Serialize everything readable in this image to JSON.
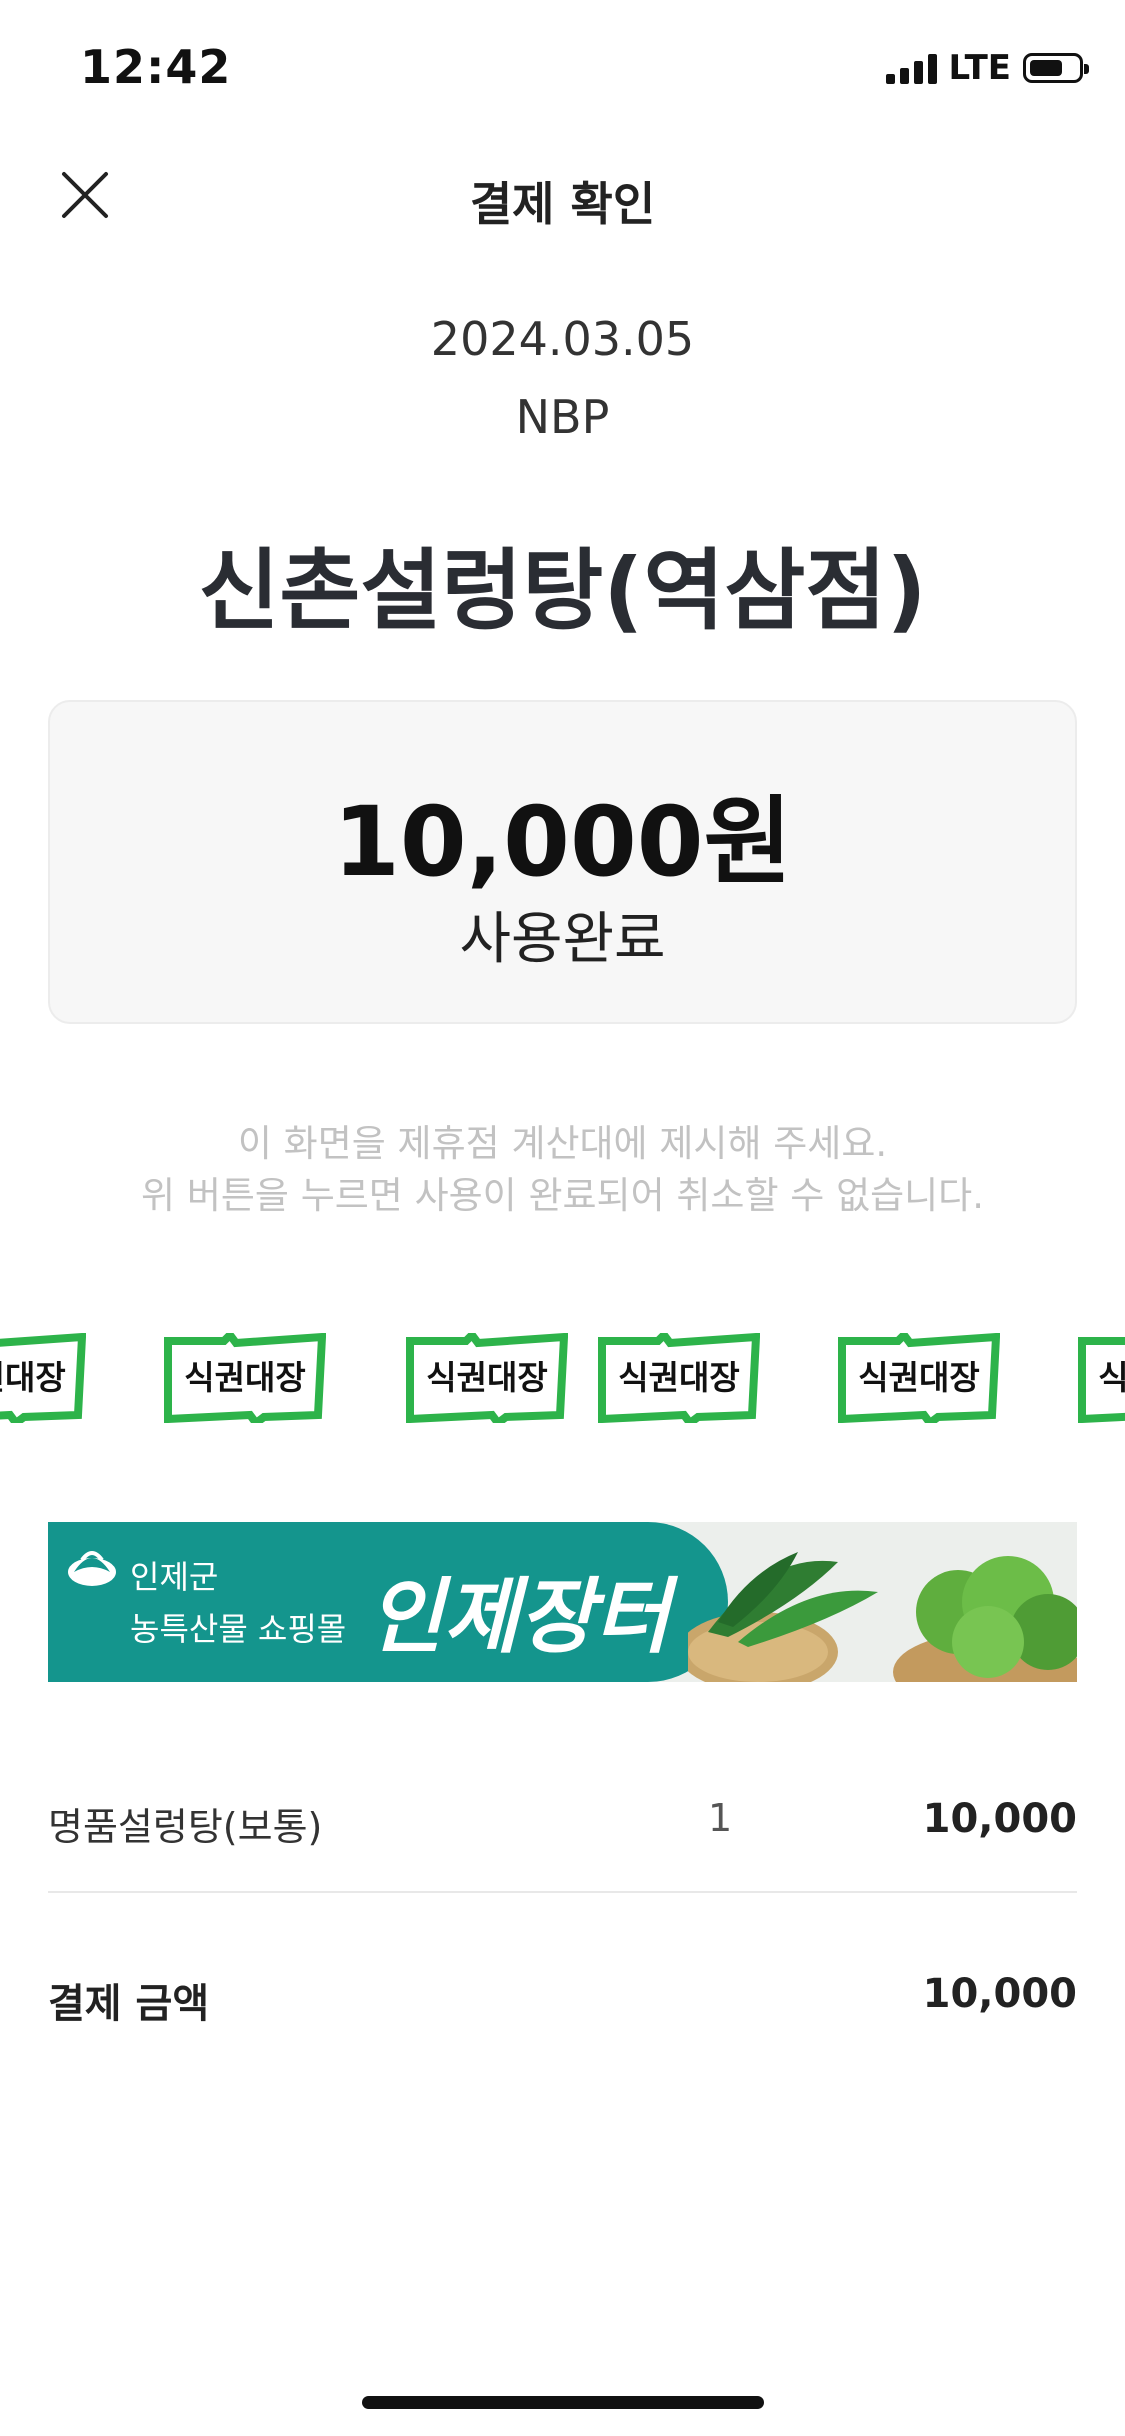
{
  "status_bar": {
    "time": "12:42",
    "network": "LTE",
    "battery_level": 0.7
  },
  "header": {
    "title": "결제 확인",
    "close_icon": "close-icon"
  },
  "receipt": {
    "date": "2024.03.05",
    "merchant": "NBP",
    "store_name": "신촌설렁탕(역삼점)",
    "amount": "10,000원",
    "status": "사용완료"
  },
  "notice": {
    "line1": "이 화면을 제휴점 계산대에 제시해 주세요.",
    "line2": "위 버튼을 누르면 사용이 완료되어 취소할 수 없습니다."
  },
  "stamps": {
    "label": "식권대장",
    "color": "#2db34a",
    "count": 6
  },
  "banner": {
    "subtitle_line1": "인제군",
    "subtitle_line2": "농특산물 쇼핑몰",
    "title": "인제장터",
    "brand_color": "#14958d"
  },
  "order": {
    "items": [
      {
        "name": "명품설렁탕(보통)",
        "qty": "1",
        "price": "10,000"
      }
    ],
    "total_label": "결제 금액",
    "total_price": "10,000"
  }
}
